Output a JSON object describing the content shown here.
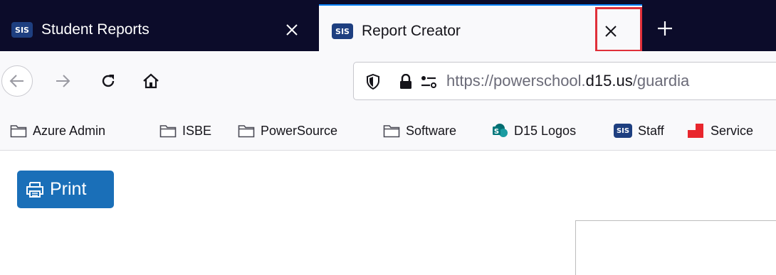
{
  "tabs": [
    {
      "badge": "SIS",
      "title": "Student Reports",
      "active": false
    },
    {
      "badge": "SIS",
      "title": "Report Creator",
      "active": true
    }
  ],
  "url": {
    "prefix": "https://powerschool.",
    "host": "d15.us",
    "path": "/guardia"
  },
  "bookmarks": [
    {
      "label": "Azure Admin",
      "icon": "folder-icon"
    },
    {
      "label": "ISBE",
      "icon": "folder-icon"
    },
    {
      "label": "PowerSource",
      "icon": "folder-icon"
    },
    {
      "label": "Software",
      "icon": "folder-icon"
    },
    {
      "label": "D15 Logos",
      "icon": "sharepoint-icon"
    },
    {
      "label": "Staff",
      "icon": "sis-icon",
      "badge": "SIS"
    },
    {
      "label": "Service",
      "icon": "service-icon"
    }
  ],
  "page": {
    "print_label": "Print"
  },
  "colors": {
    "tabbar": "#0c0c2a",
    "accent": "#0a84ff",
    "print_button": "#1a6fb8",
    "highlight": "#e0303a",
    "sis_badge": "#1e3f80"
  }
}
